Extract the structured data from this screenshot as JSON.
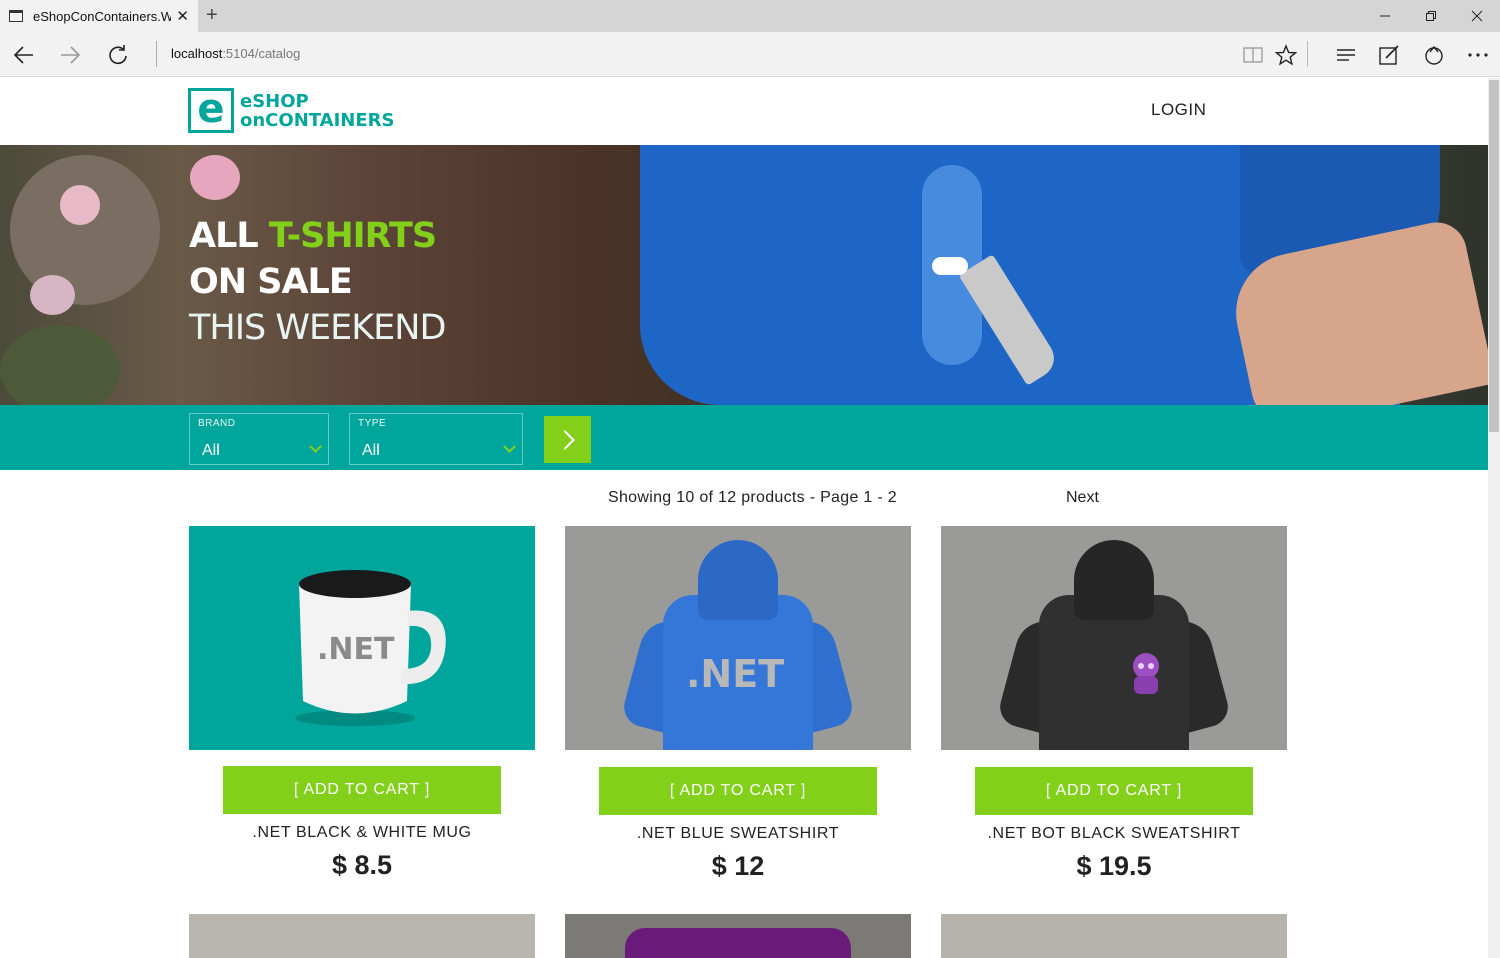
{
  "browser": {
    "tab_title": "eShopConContainers.W",
    "new_tab_symbol": "+",
    "close_symbol": "✕",
    "url_host": "localhost",
    "url_rest": ":5104/catalog"
  },
  "header": {
    "logo_letter": "e",
    "logo_line1": "eSHOP",
    "logo_line2": "onCONTAINERS",
    "login_label": "LOGIN"
  },
  "hero": {
    "word_all": "ALL ",
    "word_tshirts": "T-SHIRTS",
    "line2": "ON SALE",
    "line3": "THIS WEEKEND"
  },
  "filters": {
    "brand_label": "BRAND",
    "brand_value": "All",
    "type_label": "TYPE",
    "type_value": "All"
  },
  "pager": {
    "status": "Showing 10 of 12 products - Page 1 - 2",
    "next_label": "Next"
  },
  "products": [
    {
      "name": ".NET BLACK & WHITE MUG",
      "price": "$ 8.5",
      "button": "[ ADD TO CART ]",
      "image_text": ".NET"
    },
    {
      "name": ".NET BLUE SWEATSHIRT",
      "price": "$ 12",
      "button": "[ ADD TO CART ]",
      "image_text": ".NET"
    },
    {
      "name": ".NET BOT BLACK SWEATSHIRT",
      "price": "$ 19.5",
      "button": "[ ADD TO CART ]"
    }
  ],
  "colors": {
    "brand_teal": "#00a69c",
    "accent_green": "#83d01b"
  }
}
